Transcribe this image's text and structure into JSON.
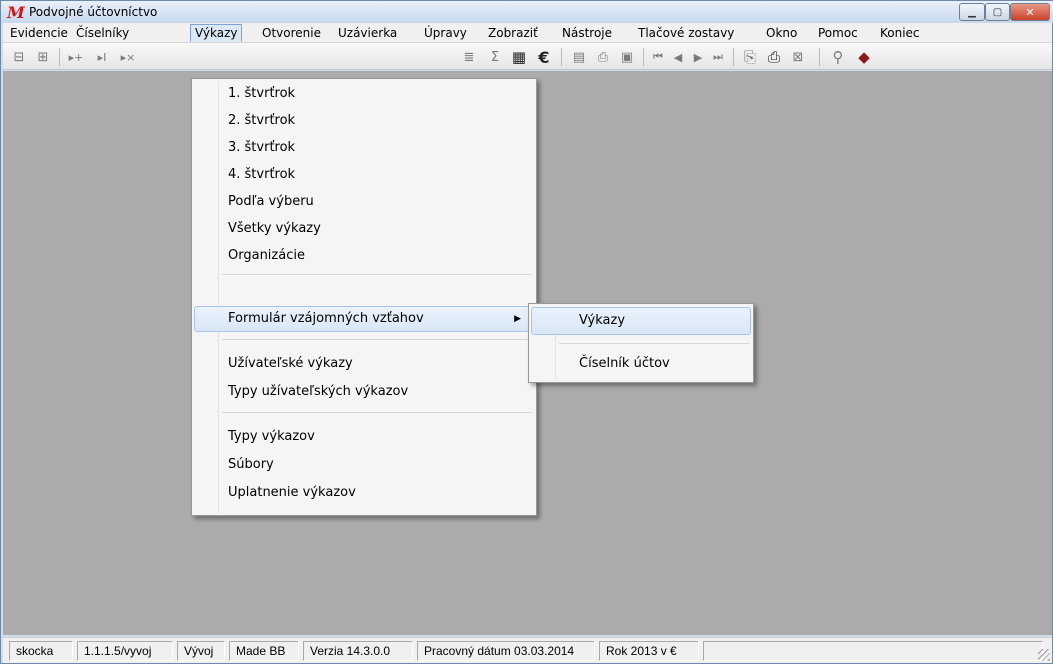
{
  "window": {
    "title": "Podvojné účtovníctvo"
  },
  "colors": {
    "client_bg": "#ababab",
    "menu_highlight": "#d9e7f6",
    "close_button": "#c8422a"
  },
  "menubar": {
    "items": [
      "Evidencie",
      "Číselníky",
      "Výkazy",
      "Otvorenie",
      "Uzávierka",
      "Úpravy",
      "Zobraziť",
      "Nástroje",
      "Tlačové zostavy",
      "Okno",
      "Pomoc",
      "Koniec"
    ],
    "open_item": "Výkazy"
  },
  "toolbar": {
    "icons": [
      "insert-record-icon",
      "delete-record-icon",
      "add-row-icon",
      "insert-row-icon",
      "remove-row-icon",
      "grid-icon",
      "sum-icon",
      "calculator-icon",
      "euro-icon",
      "note-icon",
      "export-icon",
      "properties-icon",
      "first-record-icon",
      "prev-record-icon",
      "next-record-icon",
      "last-record-icon",
      "print-preview-icon",
      "print-icon",
      "report-icon",
      "search-icon",
      "book-icon"
    ],
    "sum_glyph": "Σ",
    "euro_glyph": "€"
  },
  "dropdown": {
    "group1": [
      "1. štvrťrok",
      "2. štvrťrok",
      "3. štvrťrok",
      "4. štvrťrok",
      "Podľa výberu",
      "Všetky výkazy",
      "Organizácie"
    ],
    "submenu_parent": "Formulár vzájomných vzťahov",
    "group3": [
      "Užívateľské výkazy",
      "Typy užívateľských výkazov"
    ],
    "group4": [
      "Typy výkazov",
      "Súbory",
      "Uplatnenie výkazov"
    ]
  },
  "submenu": {
    "items": [
      "Výkazy",
      "Číselník účtov"
    ],
    "highlighted": "Výkazy"
  },
  "statusbar": {
    "panels": [
      "skocka",
      "1.1.1.5/vyvoj",
      "Vývoj",
      "Made BB",
      "Verzia 14.3.0.0",
      "Pracovný dátum 03.03.2014",
      "Rok 2013 v €",
      ""
    ]
  }
}
